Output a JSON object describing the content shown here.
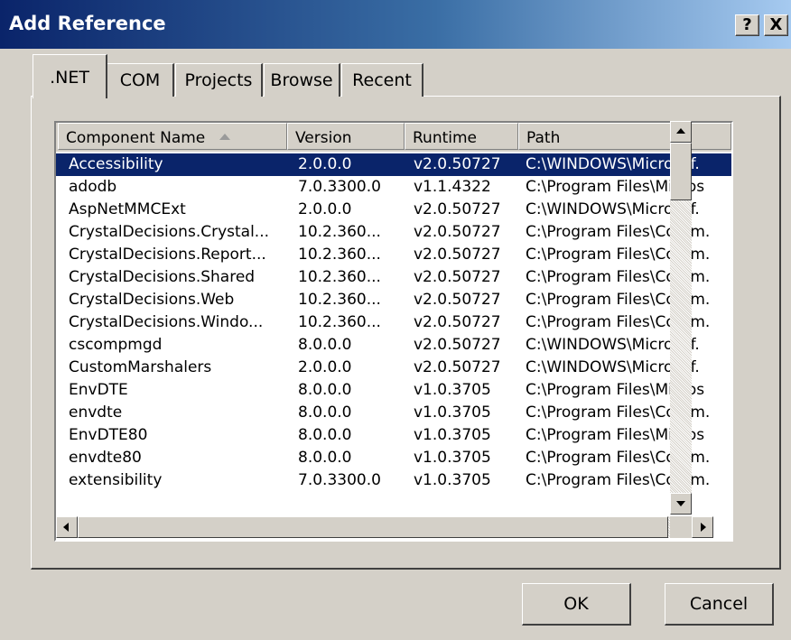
{
  "window": {
    "title": "Add Reference",
    "help_label": "?",
    "close_label": "X"
  },
  "tabs": [
    {
      "label": ".NET",
      "active": true
    },
    {
      "label": "COM",
      "active": false
    },
    {
      "label": "Projects",
      "active": false
    },
    {
      "label": "Browse",
      "active": false
    },
    {
      "label": "Recent",
      "active": false
    }
  ],
  "list": {
    "columns": [
      "Component Name",
      "Version",
      "Runtime",
      "Path"
    ],
    "sort_column": "Component Name",
    "sort_direction": "ascending",
    "selected_row": 0,
    "rows": [
      {
        "name": "Accessibility",
        "version": "2.0.0.0",
        "runtime": "v2.0.50727",
        "path": "C:\\WINDOWS\\Microsof."
      },
      {
        "name": "adodb",
        "version": "7.0.3300.0",
        "runtime": "v1.1.4322",
        "path": "C:\\Program Files\\Micros"
      },
      {
        "name": "AspNetMMCExt",
        "version": "2.0.0.0",
        "runtime": "v2.0.50727",
        "path": "C:\\WINDOWS\\Microsof."
      },
      {
        "name": "CrystalDecisions.Crystal...",
        "version": "10.2.360...",
        "runtime": "v2.0.50727",
        "path": "C:\\Program Files\\Comm."
      },
      {
        "name": "CrystalDecisions.Report...",
        "version": "10.2.360...",
        "runtime": "v2.0.50727",
        "path": "C:\\Program Files\\Comm."
      },
      {
        "name": "CrystalDecisions.Shared",
        "version": "10.2.360...",
        "runtime": "v2.0.50727",
        "path": "C:\\Program Files\\Comm."
      },
      {
        "name": "CrystalDecisions.Web",
        "version": "10.2.360...",
        "runtime": "v2.0.50727",
        "path": "C:\\Program Files\\Comm."
      },
      {
        "name": "CrystalDecisions.Windo...",
        "version": "10.2.360...",
        "runtime": "v2.0.50727",
        "path": "C:\\Program Files\\Comm."
      },
      {
        "name": "cscompmgd",
        "version": "8.0.0.0",
        "runtime": "v2.0.50727",
        "path": "C:\\WINDOWS\\Microsof."
      },
      {
        "name": "CustomMarshalers",
        "version": "2.0.0.0",
        "runtime": "v2.0.50727",
        "path": "C:\\WINDOWS\\Microsof."
      },
      {
        "name": "EnvDTE",
        "version": "8.0.0.0",
        "runtime": "v1.0.3705",
        "path": "C:\\Program Files\\Micros"
      },
      {
        "name": "envdte",
        "version": "8.0.0.0",
        "runtime": "v1.0.3705",
        "path": "C:\\Program Files\\Comm."
      },
      {
        "name": "EnvDTE80",
        "version": "8.0.0.0",
        "runtime": "v1.0.3705",
        "path": "C:\\Program Files\\Micros"
      },
      {
        "name": "envdte80",
        "version": "8.0.0.0",
        "runtime": "v1.0.3705",
        "path": "C:\\Program Files\\Comm."
      },
      {
        "name": "extensibility",
        "version": "7.0.3300.0",
        "runtime": "v1.0.3705",
        "path": "C:\\Program Files\\Comm."
      }
    ]
  },
  "buttons": {
    "ok_label": "OK",
    "cancel_label": "Cancel"
  },
  "colors": {
    "title_gradient_start": "#0a246a",
    "title_gradient_end": "#a6caf0",
    "selection": "#0a246a",
    "face": "#d4d0c8"
  }
}
